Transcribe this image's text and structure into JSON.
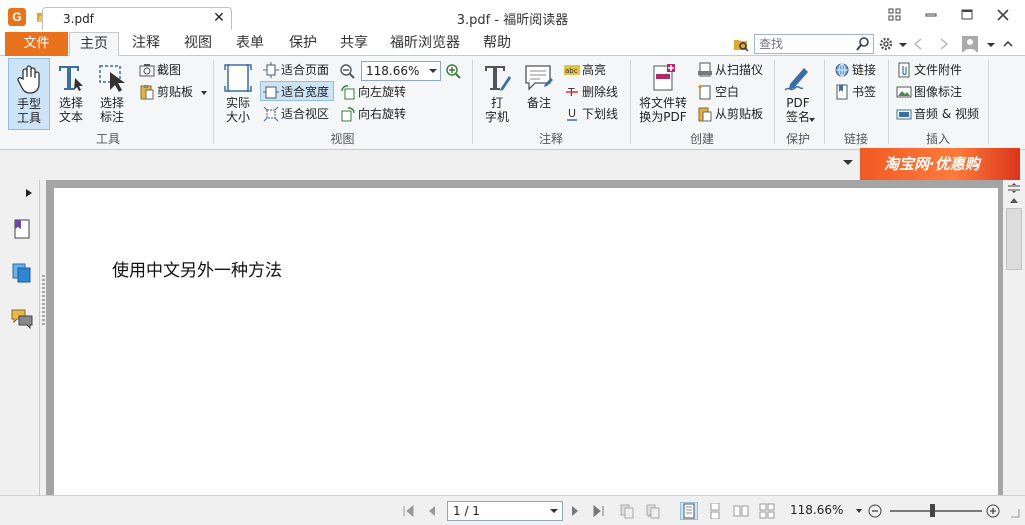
{
  "window": {
    "title": "3.pdf - 福昕阅读器",
    "logo_letter": "G"
  },
  "menu": {
    "file": "文件",
    "tabs": [
      "主页",
      "注释",
      "视图",
      "表单",
      "保护",
      "共享",
      "福昕浏览器",
      "帮助"
    ],
    "active_tab": "主页",
    "search_placeholder": "查找"
  },
  "ribbon": {
    "tools": {
      "hand": "手型\n工具",
      "select_text": "选择\n文本",
      "select_annot": "选择\n标注",
      "screenshot": "截图",
      "clipboard": "剪贴板",
      "label": "工具"
    },
    "view": {
      "actual_size": "实际\n大小",
      "fit_page": "适合页面",
      "fit_width": "适合宽度",
      "fit_visible": "适合视区",
      "zoom_value": "118.66%",
      "rotate_left": "向左旋转",
      "rotate_right": "向右旋转",
      "label": "视图"
    },
    "comment": {
      "typewriter": "打\n字机",
      "note": "备注",
      "highlight": "高亮",
      "strikeout": "删除线",
      "underline": "下划线",
      "label": "注释"
    },
    "create": {
      "convert": "将文件转\n换为PDF",
      "from_scanner": "从扫描仪",
      "blank": "空白",
      "from_clipboard": "从剪贴板",
      "label": "创建"
    },
    "protect": {
      "pdf_sign": "PDF\n签名",
      "label": "保护"
    },
    "links": {
      "link": "链接",
      "bookmark": "书签",
      "label": "链接"
    },
    "insert": {
      "attachment": "文件附件",
      "image_annot": "图像标注",
      "audio_video": "音频 & 视频",
      "label": "插入"
    }
  },
  "doc_tab": {
    "name": "3.pdf"
  },
  "ad": {
    "text": "淘宝网·优惠购"
  },
  "page": {
    "text": "使用中文另外一种方法"
  },
  "status": {
    "page": "1 / 1",
    "zoom": "118.66%",
    "zoom_level": 0.46
  }
}
